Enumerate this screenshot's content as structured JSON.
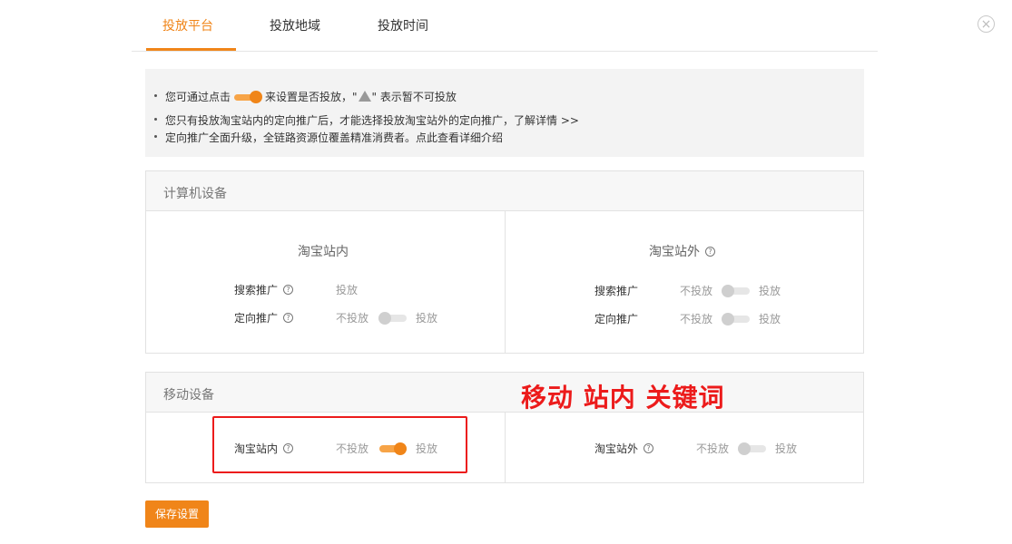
{
  "tabs": [
    {
      "label": "投放平台",
      "active": true
    },
    {
      "label": "投放地域",
      "active": false
    },
    {
      "label": "投放时间",
      "active": false
    }
  ],
  "close_icon": "close-icon",
  "notice": {
    "line1_before": "您可通过点击",
    "line1_after": "来设置是否投放，\"",
    "line1_end": "\" 表示暂不可投放",
    "line2_text": "您只有投放淘宝站内的定向推广后，才能选择投放淘宝站外的定向推广，",
    "line2_link": "了解详情 >>",
    "line3_text": "定向推广全面升级，全链路资源位覆盖精准消费者。点此查看详细介绍"
  },
  "computer": {
    "title": "计算机设备",
    "inside": {
      "title": "淘宝站内",
      "rows": [
        {
          "label": "搜索推广",
          "state": "投放"
        },
        {
          "label": "定向推广",
          "off": "不投放",
          "on": "投放",
          "toggle": false
        }
      ]
    },
    "outside": {
      "title": "淘宝站外",
      "rows": [
        {
          "label": "搜索推广",
          "off": "不投放",
          "on": "投放",
          "toggle": false
        },
        {
          "label": "定向推广",
          "off": "不投放",
          "on": "投放",
          "toggle": false
        }
      ]
    }
  },
  "mobile": {
    "title": "移动设备",
    "inside": {
      "label": "淘宝站内",
      "off": "不投放",
      "on": "投放",
      "toggle": true
    },
    "outside": {
      "label": "淘宝站外",
      "off": "不投放",
      "on": "投放",
      "toggle": false
    }
  },
  "annotation": {
    "text": "移动  站内  关键词",
    "color": "#ec1b1b"
  },
  "save_button": "保存设置",
  "colors": {
    "accent": "#f08519"
  }
}
